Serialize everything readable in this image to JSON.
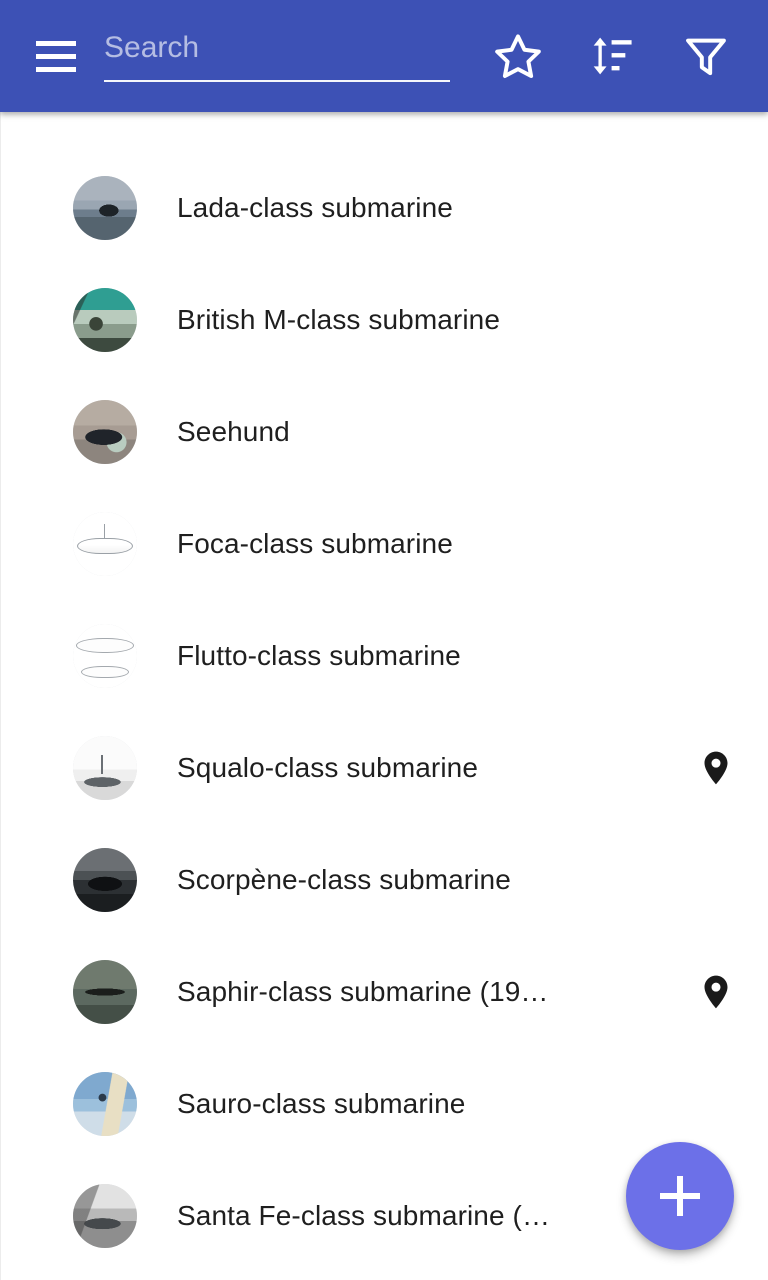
{
  "appbar": {
    "background_color": "#3d51b5",
    "menu_icon": "hamburger-menu-icon",
    "search": {
      "placeholder": "Search",
      "value": ""
    },
    "actions": [
      {
        "name": "star-icon",
        "label": "Favorites"
      },
      {
        "name": "sort-icon",
        "label": "Sort"
      },
      {
        "name": "filter-icon",
        "label": "Filter"
      }
    ]
  },
  "list": {
    "items": [
      {
        "label": "Lada-class submarine",
        "thumb": "thumb-lada",
        "has_pin": false
      },
      {
        "label": "British M-class submarine",
        "thumb": "thumb-mclass",
        "has_pin": false
      },
      {
        "label": "Seehund",
        "thumb": "thumb-seehund",
        "has_pin": false
      },
      {
        "label": "Foca-class submarine",
        "thumb": "thumb-line",
        "has_pin": false
      },
      {
        "label": "Flutto-class submarine",
        "thumb": "thumb-line2",
        "has_pin": false
      },
      {
        "label": "Squalo-class submarine",
        "thumb": "thumb-sketch",
        "has_pin": true
      },
      {
        "label": "Scorpène-class submarine",
        "thumb": "thumb-scorpene",
        "has_pin": false
      },
      {
        "label": "Saphir-class submarine (19…",
        "thumb": "thumb-saphir",
        "has_pin": true
      },
      {
        "label": "Sauro-class submarine",
        "thumb": "thumb-sauro",
        "has_pin": false
      },
      {
        "label": "Santa Fe-class submarine (…",
        "thumb": "thumb-santafe",
        "has_pin": false
      }
    ]
  },
  "fab": {
    "name": "add-button",
    "label": "+",
    "color": "#6c70e8"
  }
}
